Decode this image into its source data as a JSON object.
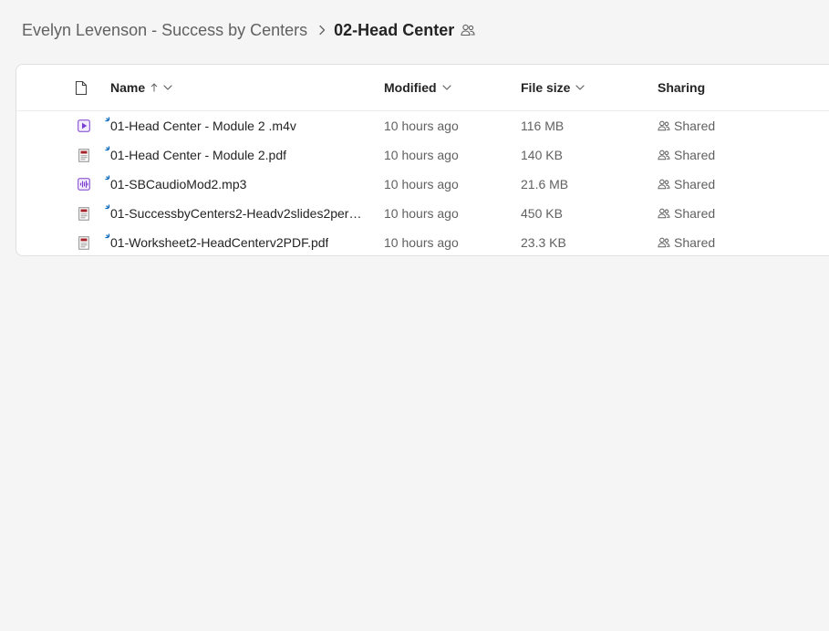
{
  "breadcrumb": {
    "parent": "Evelyn Levenson - Success by Centers",
    "current": "02-Head Center",
    "separator_icon": "chevron-right-icon",
    "share_icon": "people-icon"
  },
  "table": {
    "columns": {
      "type_icon": "document-icon",
      "name": "Name",
      "modified": "Modified",
      "file_size": "File size",
      "sharing": "Sharing"
    },
    "rows": [
      {
        "type_icon": "video-file-icon",
        "name": "01-Head Center - Module 2 .m4v",
        "modified": "10 hours ago",
        "size": "116 MB",
        "sharing": "Shared"
      },
      {
        "type_icon": "pdf-file-icon",
        "name": "01-Head Center - Module 2.pdf",
        "modified": "10 hours ago",
        "size": "140 KB",
        "sharing": "Shared"
      },
      {
        "type_icon": "audio-file-icon",
        "name": "01-SBCaudioMod2.mp3",
        "modified": "10 hours ago",
        "size": "21.6 MB",
        "sharing": "Shared"
      },
      {
        "type_icon": "pdf-file-icon",
        "name": "01-SuccessbyCenters2-Headv2slides2perpa...",
        "modified": "10 hours ago",
        "size": "450 KB",
        "sharing": "Shared"
      },
      {
        "type_icon": "pdf-file-icon",
        "name": "01-Worksheet2-HeadCenterv2PDF.pdf",
        "modified": "10 hours ago",
        "size": "23.3 KB",
        "sharing": "Shared"
      }
    ]
  },
  "colors": {
    "background": "#f5f5f5",
    "card": "#ffffff",
    "text_primary": "#242424",
    "text_secondary": "#616161",
    "new_indicator": "#0f6cbd",
    "video_icon": "#7a3fd1",
    "pdf_icon": "#a4262c",
    "audio_icon": "#7a3fd1"
  }
}
